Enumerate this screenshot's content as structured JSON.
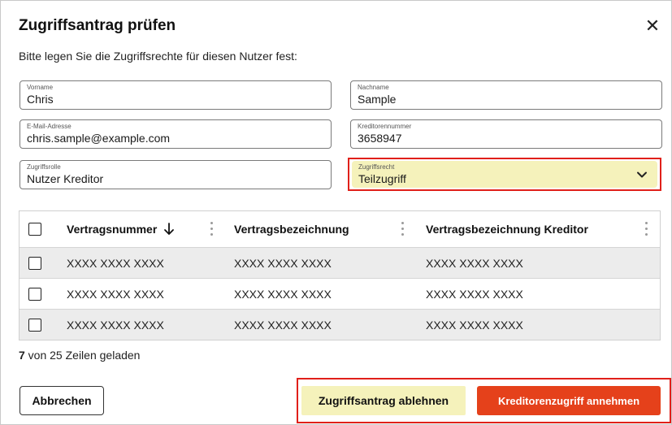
{
  "dialog": {
    "title": "Zugriffsantrag prüfen",
    "close_icon": "close-icon",
    "subtitle": "Bitte legen Sie die Zugriffsrechte für diesen Nutzer fest:"
  },
  "form": {
    "vorname": {
      "label": "Vorname",
      "value": "Chris"
    },
    "nachname": {
      "label": "Nachname",
      "value": "Sample"
    },
    "email": {
      "label": "E-Mail-Adresse",
      "value": "chris.sample@example.com"
    },
    "kreditorennummer": {
      "label": "Kreditorennummer",
      "value": "3658947"
    },
    "zugriffsrolle": {
      "label": "Zugriffsrolle",
      "value": "Nutzer Kreditor"
    },
    "zugriffsrecht": {
      "label": "Zugriffsrecht",
      "value": "Teilzugriff",
      "icon": "chevron-down-icon"
    }
  },
  "table": {
    "headers": [
      "Vertragsnummer",
      "Vertragsbezeichnung",
      "Vertragsbezeichnung Kreditor"
    ],
    "sort_icon": "arrow-down-icon",
    "rows": [
      [
        "XXXX XXXX XXXX",
        "XXXX XXXX XXXX",
        "XXXX XXXX XXXX"
      ],
      [
        "XXXX XXXX XXXX",
        "XXXX XXXX XXXX",
        "XXXX XXXX XXXX"
      ],
      [
        "XXXX XXXX XXXX",
        "XXXX XXXX XXXX",
        "XXXX XXXX XXXX"
      ]
    ]
  },
  "status": {
    "loaded": "7",
    "rest": " von 25 Zeilen geladen"
  },
  "footer": {
    "cancel_label": "Abbrechen",
    "reject_label": "Zugriffsantrag ablehnen",
    "accept_label": "Kreditorenzugriff annehmen"
  },
  "colors": {
    "accent": "#e5411b",
    "highlight_fill": "#f5f2bb",
    "highlight_border": "#e0201a",
    "row_alt": "#ececec"
  }
}
